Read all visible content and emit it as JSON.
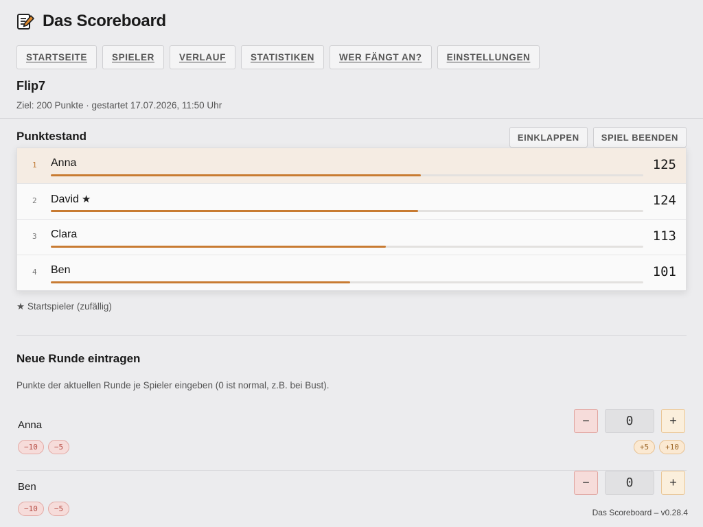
{
  "header": {
    "title": "Das Scoreboard",
    "logo_icon": "notepad-pencil-icon"
  },
  "nav": [
    {
      "label": "STARTSEITE"
    },
    {
      "label": "SPIELER"
    },
    {
      "label": "VERLAUF"
    },
    {
      "label": "STATISTIKEN"
    },
    {
      "label": "WER FÄNGT AN?"
    },
    {
      "label": "EINSTELLUNGEN"
    }
  ],
  "game": {
    "name": "Flip7",
    "meta": "Ziel: 200 Punkte · gestartet 17.07.2026, 11:50 Uhr"
  },
  "scoreboard": {
    "title": "Punktestand",
    "collapse_label": "EINKLAPPEN",
    "end_label": "SPIEL BEENDEN",
    "goal": 200,
    "rows": [
      {
        "rank": "1",
        "name": "Anna",
        "score": "125",
        "starter": false,
        "progress": 0.625
      },
      {
        "rank": "2",
        "name": "David",
        "score": "124",
        "starter": true,
        "progress": 0.62
      },
      {
        "rank": "3",
        "name": "Clara",
        "score": "113",
        "starter": false,
        "progress": 0.565
      },
      {
        "rank": "4",
        "name": "Ben",
        "score": "101",
        "starter": false,
        "progress": 0.505
      }
    ],
    "legend": "★ Startspieler (zufällig)",
    "star_icon": "star-icon"
  },
  "new_round": {
    "title": "Neue Runde eintragen",
    "hint": "Punkte der aktuellen Runde je Spieler eingeben (0 ist normal, z.B. bei Bust).",
    "minus_label": "−",
    "plus_label": "+",
    "chips_neg": [
      "−10",
      "−5"
    ],
    "chips_pos": [
      "+5",
      "+10"
    ],
    "entries": [
      {
        "name": "Anna",
        "value": "0",
        "show_pos_chips": true
      },
      {
        "name": "Ben",
        "value": "0",
        "show_pos_chips": false
      }
    ]
  },
  "footer": {
    "version": "Das Scoreboard – v0.28.4"
  },
  "colors": {
    "accent": "#c87b32",
    "leader_bg": "#f5ece3",
    "neg": "#b54a42",
    "pos": "#9c6526"
  }
}
